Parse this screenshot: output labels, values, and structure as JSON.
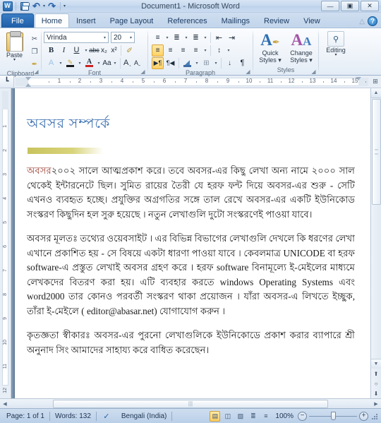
{
  "window": {
    "title": "Document1 - Microsoft Word",
    "app_icon": "word-icon",
    "app_icon_letter": "W",
    "quick_access": [
      {
        "name": "save",
        "icon": "save-icon"
      },
      {
        "name": "undo",
        "icon": "undo-icon"
      },
      {
        "name": "redo",
        "icon": "redo-icon"
      },
      {
        "name": "customize-quick-access-toolbar",
        "icon": "chevron-down-icon"
      }
    ],
    "controls": {
      "minimize": "—",
      "maximize": "▣",
      "close": "✕"
    }
  },
  "tabs": [
    {
      "label": "File",
      "active": false,
      "is_file": true
    },
    {
      "label": "Home",
      "active": true
    },
    {
      "label": "Insert",
      "active": false
    },
    {
      "label": "Page Layout",
      "active": false
    },
    {
      "label": "References",
      "active": false
    },
    {
      "label": "Mailings",
      "active": false
    },
    {
      "label": "Review",
      "active": false
    },
    {
      "label": "View",
      "active": false
    }
  ],
  "tab_right": {
    "minimize_ribbon_icon": "chevron-up-icon",
    "help_label": "?"
  },
  "ribbon": {
    "groups": [
      {
        "name": "clipboard",
        "label": "Clipboard",
        "paste_label": "Paste",
        "paste_caret": "▾",
        "buttons": [
          {
            "name": "cut",
            "icon": "scissors-icon",
            "glyph": "✂"
          },
          {
            "name": "copy",
            "icon": "copy-icon",
            "glyph": "❐"
          },
          {
            "name": "format-painter",
            "icon": "paintbrush-icon",
            "glyph": "✒"
          }
        ],
        "dialog_launcher": "⬎"
      },
      {
        "name": "font",
        "label": "Font",
        "font_name": "Vrinda",
        "font_size": "20",
        "buttons": [
          {
            "name": "bold",
            "glyph": "B"
          },
          {
            "name": "italic",
            "glyph": "I"
          },
          {
            "name": "underline",
            "glyph": "U"
          },
          {
            "name": "strikethrough",
            "glyph": "abc"
          },
          {
            "name": "subscript",
            "glyph": "x₂"
          },
          {
            "name": "superscript",
            "glyph": "x²"
          },
          {
            "name": "clear-formatting",
            "glyph": "✐"
          },
          {
            "name": "text-effects",
            "glyph": "A"
          },
          {
            "name": "text-highlight-color",
            "glyph": "ab"
          },
          {
            "name": "font-color",
            "glyph": "A"
          },
          {
            "name": "change-case",
            "glyph": "Aa"
          },
          {
            "name": "grow-font",
            "glyph": "A˄"
          },
          {
            "name": "shrink-font",
            "glyph": "A˅"
          }
        ],
        "dialog_launcher": "⬎"
      },
      {
        "name": "paragraph",
        "label": "Paragraph",
        "buttons": [
          {
            "name": "bullets",
            "glyph": "≡"
          },
          {
            "name": "numbering",
            "glyph": "≡"
          },
          {
            "name": "multilevel-list",
            "glyph": "≡"
          },
          {
            "name": "decrease-indent",
            "glyph": "⇤"
          },
          {
            "name": "increase-indent",
            "glyph": "⇥"
          },
          {
            "name": "align-left",
            "glyph": "≡",
            "selected": true
          },
          {
            "name": "center",
            "glyph": "≡"
          },
          {
            "name": "align-right",
            "glyph": "≡"
          },
          {
            "name": "justify",
            "glyph": "≡"
          },
          {
            "name": "line-spacing",
            "glyph": "↕"
          },
          {
            "name": "ltr-text-direction",
            "glyph": "¶",
            "selected": true
          },
          {
            "name": "rtl-text-direction",
            "glyph": "¶"
          },
          {
            "name": "shading",
            "glyph": "◣"
          },
          {
            "name": "borders",
            "glyph": "⊞"
          },
          {
            "name": "sort",
            "glyph": "↓"
          },
          {
            "name": "show-formatting-marks",
            "glyph": "¶"
          }
        ],
        "dialog_launcher": "⬎"
      },
      {
        "name": "styles",
        "label": "Styles",
        "buttons": [
          {
            "name": "quick-styles",
            "line1": "Quick",
            "line2": "Styles ▾"
          },
          {
            "name": "change-styles",
            "line1": "Change",
            "line2": "Styles ▾"
          }
        ],
        "dialog_launcher": "⬎"
      },
      {
        "name": "editing",
        "label": "",
        "buttons": [
          {
            "name": "editing",
            "label": "Editing",
            "caret": "▾",
            "icon": "binoculars-icon",
            "glyph": "⚲"
          }
        ]
      }
    ]
  },
  "ruler": {
    "tab_stop_selector": "┗",
    "numbers": [
      "1",
      "2",
      "3",
      "4",
      "5",
      "6",
      "7",
      "8",
      "9",
      "10",
      "11",
      "12",
      "13",
      "14",
      "15"
    ],
    "vertical_numbers": [
      "1",
      "2",
      "3",
      "4",
      "5",
      "6",
      "7",
      "8",
      "9",
      "10",
      "11",
      "12"
    ],
    "end_button_icon": "ruler-toggle-icon"
  },
  "document": {
    "title_text": "অবসর  সম্পর্কে",
    "title_color": "#3e72b4",
    "highlight_color": "#c9c35e",
    "paragraphs": [
      {
        "name": "paragraph-1",
        "lead_word": "অবসর",
        "lead_word_color": "#9c3a2c",
        "rest": "২০০২ সালে আত্মপ্রকাশ করে। তবে অবসর-এর কিছু লেখা অন্য নামে ২০০০ সাল থেকেই ইন্টারনেটে ছিল। সুমিত রায়ের তৈরী যে হরফ ফন্ট দিয়ে অবসর-এর শুরু - সেটি এখনও ব্যবহৃত হচ্ছে। প্রযুক্তির অগ্রগতির সঙ্গে তাল রেখে অবসর-এর একটি ইউনিকোড সংস্করণ কিছুদিন হল সুরু হয়েছে । নতুন লেখাগুলি দুটো সংস্করণেই পাওয়া যাবে।"
      },
      {
        "name": "paragraph-2",
        "lead_word": "",
        "rest": "অবসর মূলতঃ তথ্যের ওয়েবসাইট । এর বিভিন্ন বিভাগের লেখাগুলি দেখলে কি ধরণের লেখা এখানে প্রকাশিত হয় - সে বিষয়ে একটা ধারণা পাওয়া যাবে । কেবলমাত্র UNICODE বা হরফ software-এ প্রস্তুত লেখাই অবসর গ্রহণ করে । হরফ software বিনামূল্যে ই-মেইলের মাধ্যমে লেখকদের বিতরণ করা হয়। এটি ব্যবহার করতে windows Operating Systems এবং word2000 তার কোনও পরবর্তী সংস্করণ থাকা প্রয়োজন । যাঁরা অবসর-এ লিখতে ইচ্ছুক, তাঁরা ই-মেইলে ( editor@abasar.net) যোগাযোগ করুন ।"
      },
      {
        "name": "paragraph-3",
        "lead_word": "",
        "rest": "কৃতজ্ঞতা স্বীকারঃ অবসর-এর পুরনো লেখাগুলিকে ইউনিকোডে প্রকাশ করার ব্যাপারে শ্রী অনুনাদ সিং আমাদের সাহায্য করে বাধিত করেছেন।"
      }
    ]
  },
  "scrollbars": {
    "up_arrow": "▲",
    "down_arrow": "▼",
    "left_arrow": "◀",
    "right_arrow": "▶",
    "previous_object": "⬆",
    "select_browse_object": "○",
    "next_object": "⬇",
    "h_thumb_grip": "|||"
  },
  "statusbar": {
    "page": "Page: 1 of 1",
    "words": "Words: 132",
    "proofing_icon": "proofing-errors-icon",
    "language": "Bengali (India)",
    "views": [
      {
        "name": "print-layout-view",
        "glyph": "▤",
        "selected": true
      },
      {
        "name": "full-screen-reading-view",
        "glyph": "◫",
        "selected": false
      },
      {
        "name": "web-layout-view",
        "glyph": "▧",
        "selected": false
      },
      {
        "name": "outline-view",
        "glyph": "≣",
        "selected": false
      },
      {
        "name": "draft-view",
        "glyph": "≡",
        "selected": false
      }
    ],
    "zoom_level": "100%",
    "zoom_out": "−",
    "zoom_in": "+"
  }
}
